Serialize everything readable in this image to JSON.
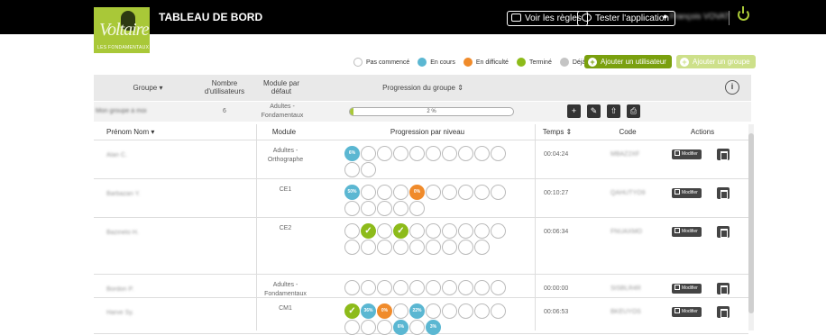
{
  "header": {
    "logo": {
      "title": "Voltaire",
      "subtitle": "LES FONDAMENTAUX"
    },
    "title": "TABLEAU DE BORD",
    "rules_button": "Voir les règles",
    "test_button": "Tester l'application",
    "user_name": "François VOVAT"
  },
  "legend": {
    "items": [
      {
        "label": "Pas commencé",
        "color": "#ffffff"
      },
      {
        "label": "En cours",
        "color": "#5bb7d2"
      },
      {
        "label": "En difficulté",
        "color": "#f08b2b"
      },
      {
        "label": "Terminé",
        "color": "#8dbb1a"
      },
      {
        "label": "Déjà terminé",
        "color": "#c4c4c4"
      }
    ]
  },
  "actions": {
    "add_user": "Ajouter un utilisateur",
    "add_group": "Ajouter un groupe"
  },
  "group_table": {
    "headers": {
      "group": "Groupe ▾",
      "users": "Nombre d'utilisateurs",
      "module": "Module par défaut",
      "progress": "Progression du groupe ⇕"
    },
    "row": {
      "name": "Mon groupe à moi",
      "users": "6",
      "module": "Adultes - Fondamentaux",
      "progress_label": "2 %",
      "progress_value": 2
    }
  },
  "users_table": {
    "headers": {
      "name": "Prénom Nom ▾",
      "module": "Module",
      "progress": "Progression par niveau",
      "time": "Temps ⇕",
      "code": "Code",
      "actions": "Actions"
    },
    "modify_label": "Modifier",
    "rows": [
      {
        "name": "Alan C.",
        "module": "Adultes - Orthographe",
        "time": "00:04:24",
        "code": "MBAZ2XF",
        "levels": [
          {
            "s": "blue",
            "t": "6%"
          },
          {
            "s": "empty"
          },
          {
            "s": "empty"
          },
          {
            "s": "empty"
          },
          {
            "s": "empty"
          },
          {
            "s": "empty"
          },
          {
            "s": "empty"
          },
          {
            "s": "empty"
          },
          {
            "s": "empty"
          },
          {
            "s": "empty"
          },
          {
            "s": "empty"
          },
          {
            "s": "empty"
          }
        ]
      },
      {
        "name": "Barbazan Y.",
        "module": "CE1",
        "time": "00:10:27",
        "code": "QAHUTYO9",
        "levels": [
          {
            "s": "blue",
            "t": "50%"
          },
          {
            "s": "empty"
          },
          {
            "s": "empty"
          },
          {
            "s": "empty"
          },
          {
            "s": "orange",
            "t": "0%"
          },
          {
            "s": "empty"
          },
          {
            "s": "empty"
          },
          {
            "s": "empty"
          },
          {
            "s": "empty"
          },
          {
            "s": "empty"
          },
          {
            "s": "empty"
          },
          {
            "s": "empty"
          },
          {
            "s": "empty"
          },
          {
            "s": "empty"
          },
          {
            "s": "empty"
          }
        ]
      },
      {
        "name": "Bazinelo H.",
        "module": "CE2",
        "time": "00:06:34",
        "code": "FNUAXMO",
        "levels": [
          {
            "s": "empty"
          },
          {
            "s": "green",
            "t": "✓"
          },
          {
            "s": "empty"
          },
          {
            "s": "green",
            "t": "✓"
          },
          {
            "s": "empty"
          },
          {
            "s": "empty"
          },
          {
            "s": "empty"
          },
          {
            "s": "empty"
          },
          {
            "s": "empty"
          },
          {
            "s": "empty"
          },
          {
            "s": "empty"
          },
          {
            "s": "empty"
          },
          {
            "s": "empty"
          },
          {
            "s": "empty"
          },
          {
            "s": "empty"
          },
          {
            "s": "empty"
          },
          {
            "s": "empty"
          },
          {
            "s": "empty"
          },
          {
            "s": "empty"
          }
        ]
      },
      {
        "name": "Bordon P.",
        "module": "Adultes - Fondamentaux",
        "time": "00:00:00",
        "code": "SISBLR4R",
        "levels": [
          {
            "s": "empty"
          },
          {
            "s": "empty"
          },
          {
            "s": "empty"
          },
          {
            "s": "empty"
          },
          {
            "s": "empty"
          },
          {
            "s": "empty"
          },
          {
            "s": "empty"
          },
          {
            "s": "empty"
          },
          {
            "s": "empty"
          },
          {
            "s": "empty"
          }
        ]
      },
      {
        "name": "Harve Sy.",
        "module": "CM1",
        "time": "00:06:53",
        "code": "BKEUYOS",
        "levels": [
          {
            "s": "green",
            "t": "✓"
          },
          {
            "s": "blue",
            "t": "36%"
          },
          {
            "s": "orange",
            "t": "0%"
          },
          {
            "s": "empty"
          },
          {
            "s": "blue",
            "t": "22%"
          },
          {
            "s": "empty"
          },
          {
            "s": "empty"
          },
          {
            "s": "empty"
          },
          {
            "s": "empty"
          },
          {
            "s": "empty"
          },
          {
            "s": "empty"
          },
          {
            "s": "empty"
          },
          {
            "s": "empty"
          },
          {
            "s": "blue",
            "t": "6%"
          },
          {
            "s": "empty"
          },
          {
            "s": "blue",
            "t": "3%"
          }
        ]
      }
    ]
  }
}
